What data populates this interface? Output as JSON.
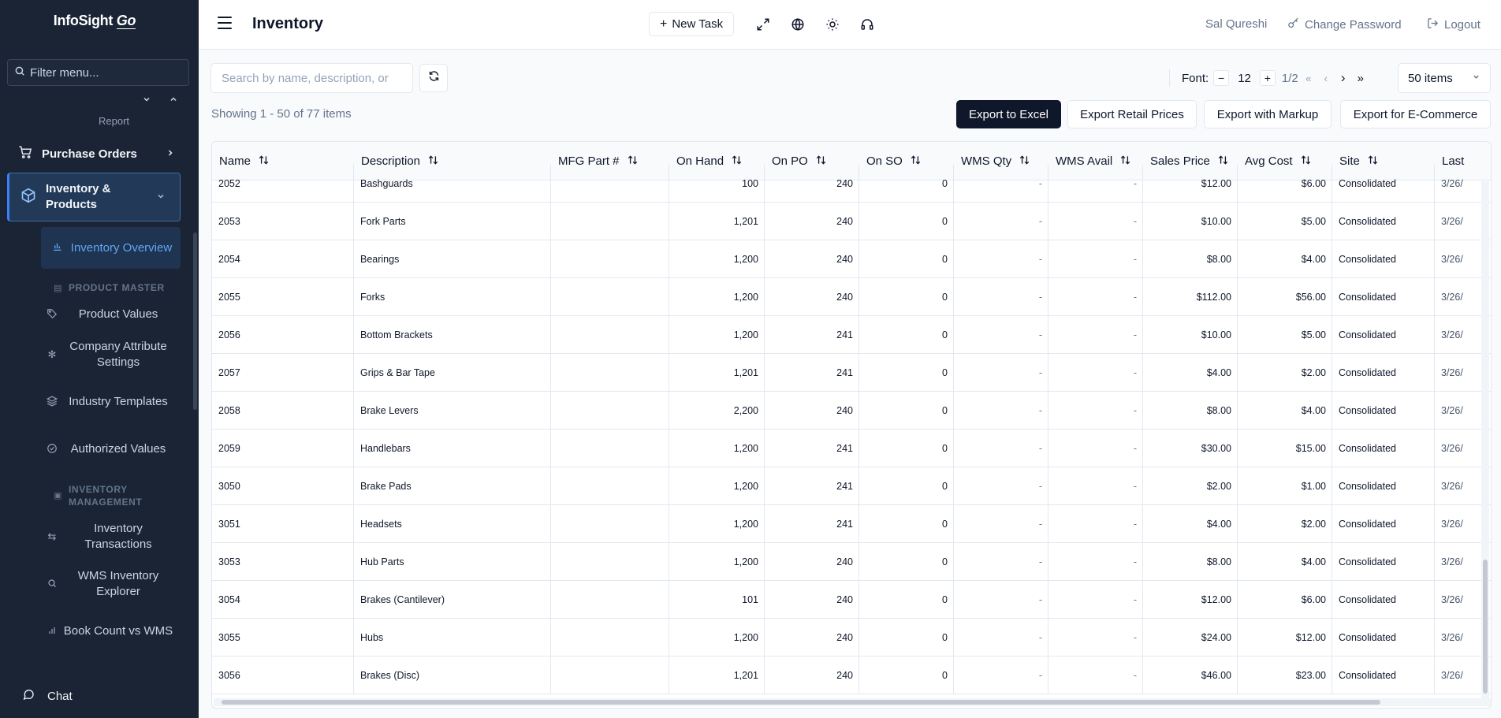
{
  "app": {
    "logo_main": "InfoSight",
    "logo_go": "Go"
  },
  "sidebar": {
    "filter_placeholder": "Filter menu...",
    "clipped_item": "Report",
    "purchase_orders": "Purchase Orders",
    "inventory_products": "Inventory & Products",
    "inventory_overview": "Inventory Overview",
    "section_product_master": "PRODUCT MASTER",
    "product_values": "Product Values",
    "company_attribute_settings": "Company Attribute Settings",
    "industry_templates": "Industry Templates",
    "authorized_values": "Authorized Values",
    "section_inventory_management": "INVENTORY MANAGEMENT",
    "inventory_transactions": "Inventory Transactions",
    "wms_inventory_explorer": "WMS Inventory Explorer",
    "book_count_vs_wms": "Book Count vs WMS",
    "chat": "Chat"
  },
  "header": {
    "title": "Inventory",
    "new_task": "New Task",
    "user_name": "Sal Qureshi",
    "change_password": "Change Password",
    "logout": "Logout"
  },
  "toolbar": {
    "search_placeholder": "Search by name, description, or",
    "font_label": "Font:",
    "font_size": "12",
    "page": "1/2",
    "items_per_page": "50 items",
    "showing": "Showing 1 - 50 of 77 items",
    "export_excel": "Export to Excel",
    "export_retail": "Export Retail Prices",
    "export_markup": "Export with Markup",
    "export_ecommerce": "Export for E-Commerce"
  },
  "table": {
    "columns": [
      "Name",
      "Description",
      "MFG Part #",
      "On Hand",
      "On PO",
      "On SO",
      "WMS Qty",
      "WMS Avail",
      "Sales Price",
      "Avg Cost",
      "Site",
      "Last"
    ],
    "rows": [
      {
        "name": "2052",
        "desc": "Bashguards",
        "mfg": "",
        "on_hand": "100",
        "on_po": "240",
        "on_so": "0",
        "wms_qty": "-",
        "wms_avail": "-",
        "sales_price": "$12.00",
        "avg_cost": "$6.00",
        "site": "Consolidated",
        "last": "3/26/"
      },
      {
        "name": "2053",
        "desc": "Fork Parts",
        "mfg": "",
        "on_hand": "1,201",
        "on_po": "240",
        "on_so": "0",
        "wms_qty": "-",
        "wms_avail": "-",
        "sales_price": "$10.00",
        "avg_cost": "$5.00",
        "site": "Consolidated",
        "last": "3/26/"
      },
      {
        "name": "2054",
        "desc": "Bearings",
        "mfg": "",
        "on_hand": "1,200",
        "on_po": "240",
        "on_so": "0",
        "wms_qty": "-",
        "wms_avail": "-",
        "sales_price": "$8.00",
        "avg_cost": "$4.00",
        "site": "Consolidated",
        "last": "3/26/"
      },
      {
        "name": "2055",
        "desc": "Forks",
        "mfg": "",
        "on_hand": "1,200",
        "on_po": "240",
        "on_so": "0",
        "wms_qty": "-",
        "wms_avail": "-",
        "sales_price": "$112.00",
        "avg_cost": "$56.00",
        "site": "Consolidated",
        "last": "3/26/"
      },
      {
        "name": "2056",
        "desc": "Bottom Brackets",
        "mfg": "",
        "on_hand": "1,200",
        "on_po": "241",
        "on_so": "0",
        "wms_qty": "-",
        "wms_avail": "-",
        "sales_price": "$10.00",
        "avg_cost": "$5.00",
        "site": "Consolidated",
        "last": "3/26/"
      },
      {
        "name": "2057",
        "desc": "Grips & Bar Tape",
        "mfg": "",
        "on_hand": "1,201",
        "on_po": "241",
        "on_so": "0",
        "wms_qty": "-",
        "wms_avail": "-",
        "sales_price": "$4.00",
        "avg_cost": "$2.00",
        "site": "Consolidated",
        "last": "3/26/"
      },
      {
        "name": "2058",
        "desc": "Brake Levers",
        "mfg": "",
        "on_hand": "2,200",
        "on_po": "240",
        "on_so": "0",
        "wms_qty": "-",
        "wms_avail": "-",
        "sales_price": "$8.00",
        "avg_cost": "$4.00",
        "site": "Consolidated",
        "last": "3/26/"
      },
      {
        "name": "2059",
        "desc": "Handlebars",
        "mfg": "",
        "on_hand": "1,200",
        "on_po": "241",
        "on_so": "0",
        "wms_qty": "-",
        "wms_avail": "-",
        "sales_price": "$30.00",
        "avg_cost": "$15.00",
        "site": "Consolidated",
        "last": "3/26/"
      },
      {
        "name": "3050",
        "desc": "Brake Pads",
        "mfg": "",
        "on_hand": "1,200",
        "on_po": "241",
        "on_so": "0",
        "wms_qty": "-",
        "wms_avail": "-",
        "sales_price": "$2.00",
        "avg_cost": "$1.00",
        "site": "Consolidated",
        "last": "3/26/"
      },
      {
        "name": "3051",
        "desc": "Headsets",
        "mfg": "",
        "on_hand": "1,200",
        "on_po": "241",
        "on_so": "0",
        "wms_qty": "-",
        "wms_avail": "-",
        "sales_price": "$4.00",
        "avg_cost": "$2.00",
        "site": "Consolidated",
        "last": "3/26/"
      },
      {
        "name": "3053",
        "desc": "Hub Parts",
        "mfg": "",
        "on_hand": "1,200",
        "on_po": "240",
        "on_so": "0",
        "wms_qty": "-",
        "wms_avail": "-",
        "sales_price": "$8.00",
        "avg_cost": "$4.00",
        "site": "Consolidated",
        "last": "3/26/"
      },
      {
        "name": "3054",
        "desc": "Brakes (Cantilever)",
        "mfg": "",
        "on_hand": "101",
        "on_po": "240",
        "on_so": "0",
        "wms_qty": "-",
        "wms_avail": "-",
        "sales_price": "$12.00",
        "avg_cost": "$6.00",
        "site": "Consolidated",
        "last": "3/26/"
      },
      {
        "name": "3055",
        "desc": "Hubs",
        "mfg": "",
        "on_hand": "1,200",
        "on_po": "240",
        "on_so": "0",
        "wms_qty": "-",
        "wms_avail": "-",
        "sales_price": "$24.00",
        "avg_cost": "$12.00",
        "site": "Consolidated",
        "last": "3/26/"
      },
      {
        "name": "3056",
        "desc": "Brakes (Disc)",
        "mfg": "",
        "on_hand": "1,201",
        "on_po": "240",
        "on_so": "0",
        "wms_qty": "-",
        "wms_avail": "-",
        "sales_price": "$46.00",
        "avg_cost": "$23.00",
        "site": "Consolidated",
        "last": "3/26/"
      }
    ]
  },
  "colors": {
    "sidebar_bg": "#1a2434",
    "accent": "#3b82f6",
    "primary_button": "#0f172a"
  }
}
